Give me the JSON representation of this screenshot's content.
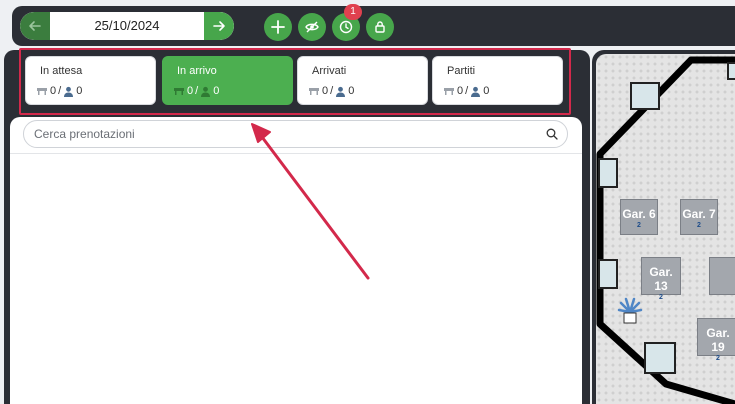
{
  "toolbar": {
    "date": "25/10/2024",
    "notification_count": "1",
    "prev_icon": "arrow-left-icon",
    "next_icon": "arrow-right-icon",
    "add_icon": "plus-icon",
    "hide_icon": "eye-off-icon",
    "clock_icon": "clock-icon",
    "lock_icon": "lock-icon"
  },
  "status_tabs": [
    {
      "label": "In attesa",
      "tables": "0",
      "guests": "0",
      "active": false
    },
    {
      "label": "In arrivo",
      "tables": "0",
      "guests": "0",
      "active": true
    },
    {
      "label": "Arrivati",
      "tables": "0",
      "guests": "0",
      "active": false
    },
    {
      "label": "Partiti",
      "tables": "0",
      "guests": "0",
      "active": false
    }
  ],
  "search": {
    "placeholder": "Cerca prenotazioni",
    "icon": "search-icon"
  },
  "floor_plan": {
    "tables": [
      {
        "name": "Gar. 6",
        "capacity": "2"
      },
      {
        "name": "Gar. 7",
        "capacity": "2"
      },
      {
        "name": "Gar. 13",
        "capacity": "2"
      },
      {
        "name": "Gar. 19",
        "capacity": "2"
      }
    ],
    "plant_icon": "potted-plant-icon"
  },
  "colors": {
    "accent": "#4caf50",
    "dark": "#2b2e35",
    "highlight": "#d3294b",
    "badge": "#e0414f"
  }
}
